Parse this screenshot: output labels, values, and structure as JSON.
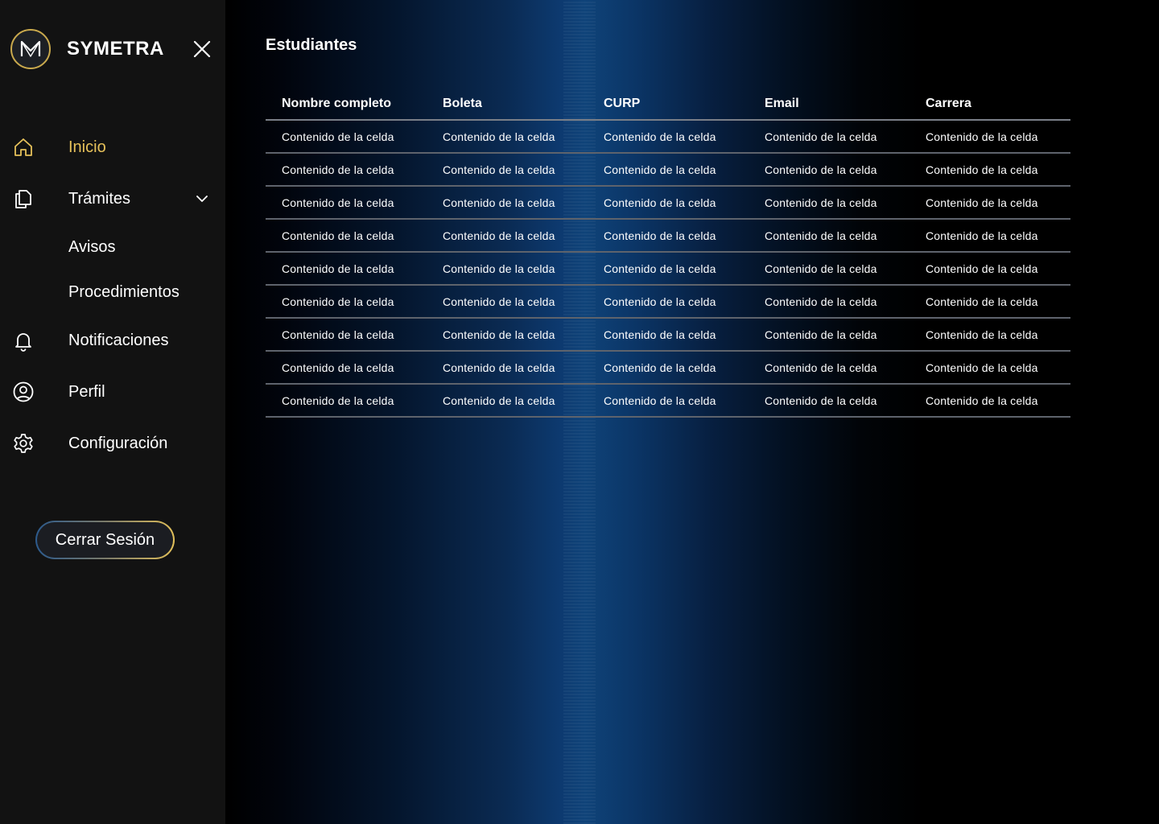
{
  "brand": {
    "name": "SYMETRA"
  },
  "colors": {
    "accent": "#e6c15a",
    "sidebar": "#121212",
    "glow": "#0f4379"
  },
  "sidebar": {
    "items": [
      {
        "label": "Inicio",
        "icon": "home-icon",
        "active": true
      },
      {
        "label": "Trámites",
        "icon": "documents-icon",
        "expanded": true
      },
      {
        "label": "Notificaciones",
        "icon": "bell-icon"
      },
      {
        "label": "Perfil",
        "icon": "user-circle-icon"
      },
      {
        "label": "Configuración",
        "icon": "gear-icon"
      }
    ],
    "subitems": [
      {
        "label": "Avisos"
      },
      {
        "label": "Procedimientos"
      }
    ],
    "logout_label": "Cerrar Sesión"
  },
  "main": {
    "title": "Estudiantes",
    "table": {
      "columns": [
        "Nombre completo",
        "Boleta",
        "CURP",
        "Email",
        "Carrera"
      ],
      "rows": [
        [
          "Contenido de la celda",
          "Contenido de la celda",
          "Contenido de la celda",
          "Contenido de la celda",
          "Contenido de la celda"
        ],
        [
          "Contenido de la celda",
          "Contenido de la celda",
          "Contenido de la celda",
          "Contenido de la celda",
          "Contenido de la celda"
        ],
        [
          "Contenido de la celda",
          "Contenido de la celda",
          "Contenido de la celda",
          "Contenido de la celda",
          "Contenido de la celda"
        ],
        [
          "Contenido de la celda",
          "Contenido de la celda",
          "Contenido de la celda",
          "Contenido de la celda",
          "Contenido de la celda"
        ],
        [
          "Contenido de la celda",
          "Contenido de la celda",
          "Contenido de la celda",
          "Contenido de la celda",
          "Contenido de la celda"
        ],
        [
          "Contenido de la celda",
          "Contenido de la celda",
          "Contenido de la celda",
          "Contenido de la celda",
          "Contenido de la celda"
        ],
        [
          "Contenido de la celda",
          "Contenido de la celda",
          "Contenido de la celda",
          "Contenido de la celda",
          "Contenido de la celda"
        ],
        [
          "Contenido de la celda",
          "Contenido de la celda",
          "Contenido de la celda",
          "Contenido de la celda",
          "Contenido de la celda"
        ],
        [
          "Contenido de la celda",
          "Contenido de la celda",
          "Contenido de la celda",
          "Contenido de la celda",
          "Contenido de la celda"
        ]
      ]
    }
  }
}
